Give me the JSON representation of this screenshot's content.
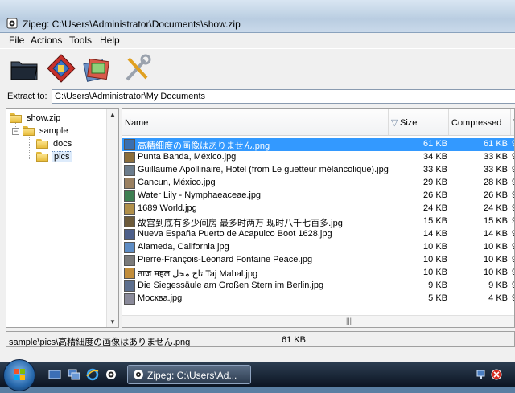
{
  "window": {
    "title": "Zipeg: C:\\Users\\Administrator\\Documents\\show.zip"
  },
  "menu": [
    "File",
    "Actions",
    "Tools",
    "Help"
  ],
  "toolbar": {
    "icons": [
      "open-archive-icon",
      "extract-icon",
      "extract-selected-icon",
      "tools-icon"
    ]
  },
  "extract": {
    "label": "Extract to:",
    "value": "C:\\Users\\Administrator\\My Documents"
  },
  "tree": {
    "root": "show.zip",
    "folder": "sample",
    "children": [
      "docs",
      "pics"
    ]
  },
  "columns": {
    "name": "Name",
    "size": "Size",
    "compressed": "Compressed",
    "extra": "T"
  },
  "files": [
    {
      "name": "高精細度の画像はありません.png",
      "size": "61 KB",
      "compressed": "61 KB",
      "extra": "9"
    },
    {
      "name": "Punta Banda, México.jpg",
      "size": "34 KB",
      "compressed": "33 KB",
      "extra": "9"
    },
    {
      "name": "Guillaume Apollinaire, Hotel (from Le guetteur mélancolique).jpg",
      "size": "33 KB",
      "compressed": "33 KB",
      "extra": "9"
    },
    {
      "name": "Cancun, México.jpg",
      "size": "29 KB",
      "compressed": "28 KB",
      "extra": "9"
    },
    {
      "name": "Water Lily - Nymphaeaceae.jpg",
      "size": "26 KB",
      "compressed": "26 KB",
      "extra": "9"
    },
    {
      "name": "1689 World.jpg",
      "size": "24 KB",
      "compressed": "24 KB",
      "extra": "9"
    },
    {
      "name": "故宫到底有多少间房 最多时两万 现时八千七百多.jpg",
      "size": "15 KB",
      "compressed": "15 KB",
      "extra": "9"
    },
    {
      "name": "Nueva España Puerto de Acapulco Boot 1628.jpg",
      "size": "14 KB",
      "compressed": "14 KB",
      "extra": "9"
    },
    {
      "name": "Alameda, California.jpg",
      "size": "10 KB",
      "compressed": "10 KB",
      "extra": "9"
    },
    {
      "name": "Pierre-François-Léonard Fontaine Peace.jpg",
      "size": "10 KB",
      "compressed": "10 KB",
      "extra": "9"
    },
    {
      "name": "ताज महल تاج محل Taj Mahal.jpg",
      "size": "10 KB",
      "compressed": "10 KB",
      "extra": "9"
    },
    {
      "name": "Die Siegessäule am Großen Stern im Berlin.jpg",
      "size": "9 KB",
      "compressed": "9 KB",
      "extra": "9"
    },
    {
      "name": "Москва.jpg",
      "size": "5 KB",
      "compressed": "4 KB",
      "extra": "9"
    }
  ],
  "status": {
    "path": "sample\\pics\\高精細度の画像はありません.png",
    "size": "61 KB"
  },
  "taskbar": {
    "task_label": "Zipeg: C:\\Users\\Ad..."
  },
  "colors": {
    "selection": "#3399ff",
    "taskbar": "#1b2738"
  }
}
